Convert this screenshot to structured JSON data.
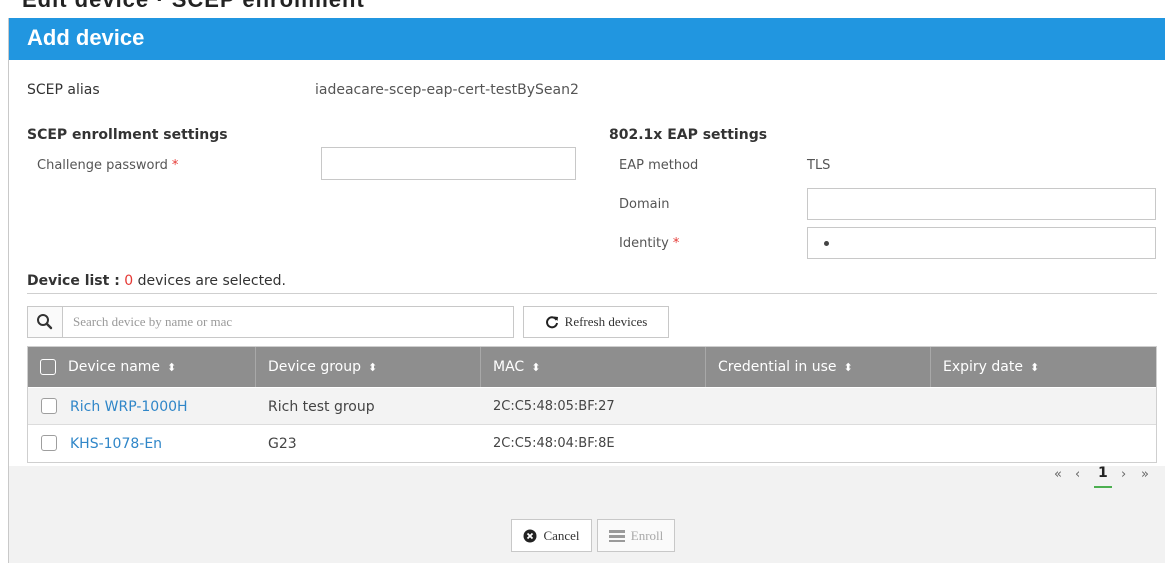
{
  "dialog": {
    "title": "Add device"
  },
  "top_clipped_text": "Edit device · SCEP enrollment",
  "scep_alias": {
    "label": "SCEP alias",
    "value": "iadeacare-scep-eap-cert-testBySean2"
  },
  "scep_settings": {
    "heading": "SCEP enrollment settings",
    "challenge_password": {
      "label": "Challenge password",
      "required_mark": "*",
      "value": "",
      "placeholder": ""
    }
  },
  "eap_settings": {
    "heading": "802.1x EAP settings",
    "method": {
      "label": "EAP method",
      "value": "TLS"
    },
    "domain": {
      "label": "Domain",
      "value": ""
    },
    "identity": {
      "label": "Identity",
      "required_mark": "*",
      "value": ""
    }
  },
  "device_list": {
    "label": "Device list :",
    "selected_count": "0",
    "suffix": "devices are selected."
  },
  "search": {
    "placeholder": "Search device by name or mac",
    "icon": "search-icon"
  },
  "refresh_button": {
    "label": "Refresh devices",
    "icon": "refresh-icon"
  },
  "table": {
    "columns": [
      "Device name",
      "Device group",
      "MAC",
      "Credential in use",
      "Expiry date"
    ],
    "sort_glyph": "⬍",
    "rows": [
      {
        "name": "Rich WRP-1000H",
        "group": "Rich test group",
        "mac": "2C:C5:48:05:BF:27",
        "credential": "",
        "expiry": ""
      },
      {
        "name": "KHS-1078-En",
        "group": "G23",
        "mac": "2C:C5:48:04:BF:8E",
        "credential": "",
        "expiry": ""
      }
    ]
  },
  "pagination": {
    "first": "«",
    "prev": "‹",
    "current": "1",
    "next": "›",
    "last": "»"
  },
  "footer": {
    "cancel_label": "Cancel",
    "enroll_label": "Enroll"
  },
  "colors": {
    "header": "#2196e0",
    "table_header": "#8e8e8e",
    "link": "#2f86c8",
    "required": "#e53935",
    "active_page": "#4caf50"
  }
}
